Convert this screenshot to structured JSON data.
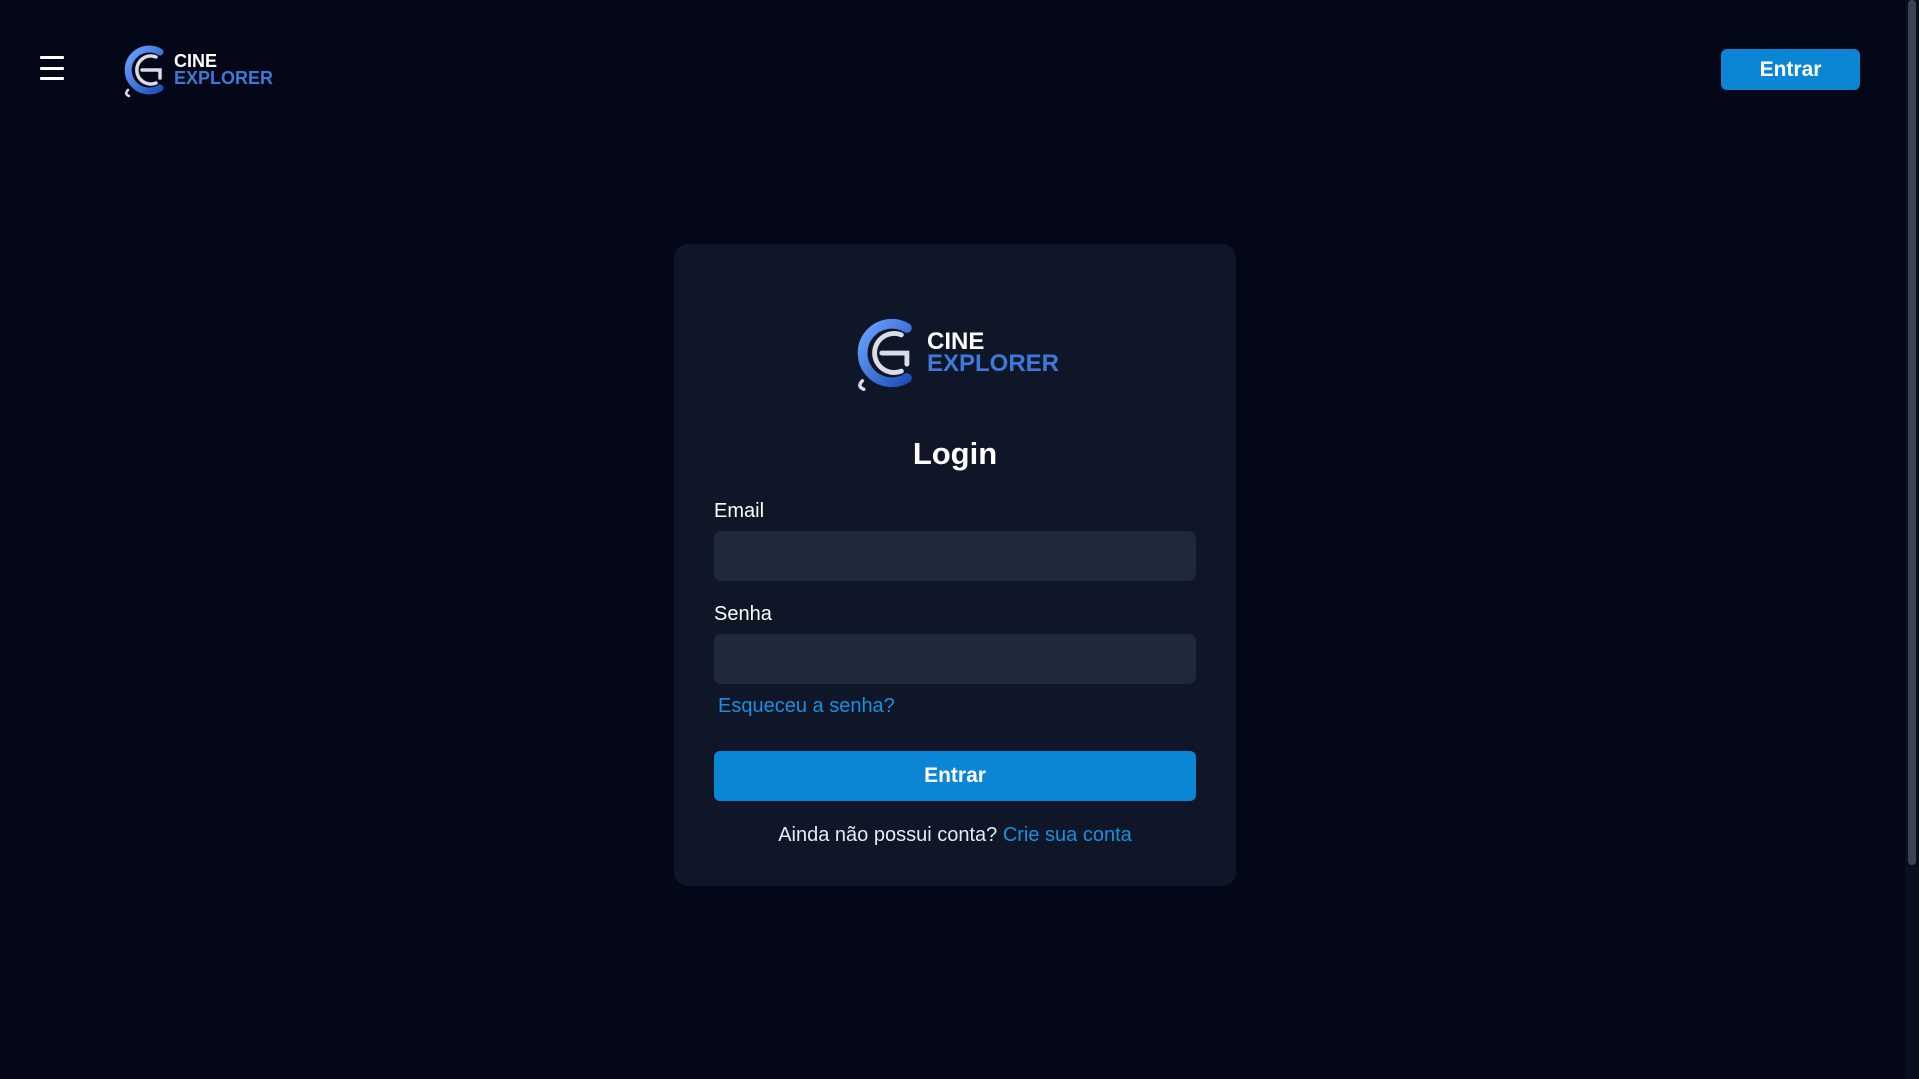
{
  "header": {
    "logo": {
      "line1": "CINE",
      "line2": "EXPLORER"
    },
    "menu_icon": "hamburger-menu-icon",
    "login_button_label": "Entrar"
  },
  "login_card": {
    "logo": {
      "line1": "CINE",
      "line2": "EXPLORER"
    },
    "title": "Login",
    "email": {
      "label": "Email",
      "value": "",
      "placeholder": ""
    },
    "password": {
      "label": "Senha",
      "value": "",
      "placeholder": ""
    },
    "forgot_password_link": "Esqueceu a senha?",
    "submit_label": "Entrar",
    "signup_prompt": "Ainda não possui conta?",
    "signup_link": "Crie sua conta"
  },
  "colors": {
    "background": "#030718",
    "card": "#0e1628",
    "input": "#1e293b",
    "accent": "#0a86d5",
    "link": "#1a8fe0",
    "logo_blue": "#3f79d8"
  }
}
